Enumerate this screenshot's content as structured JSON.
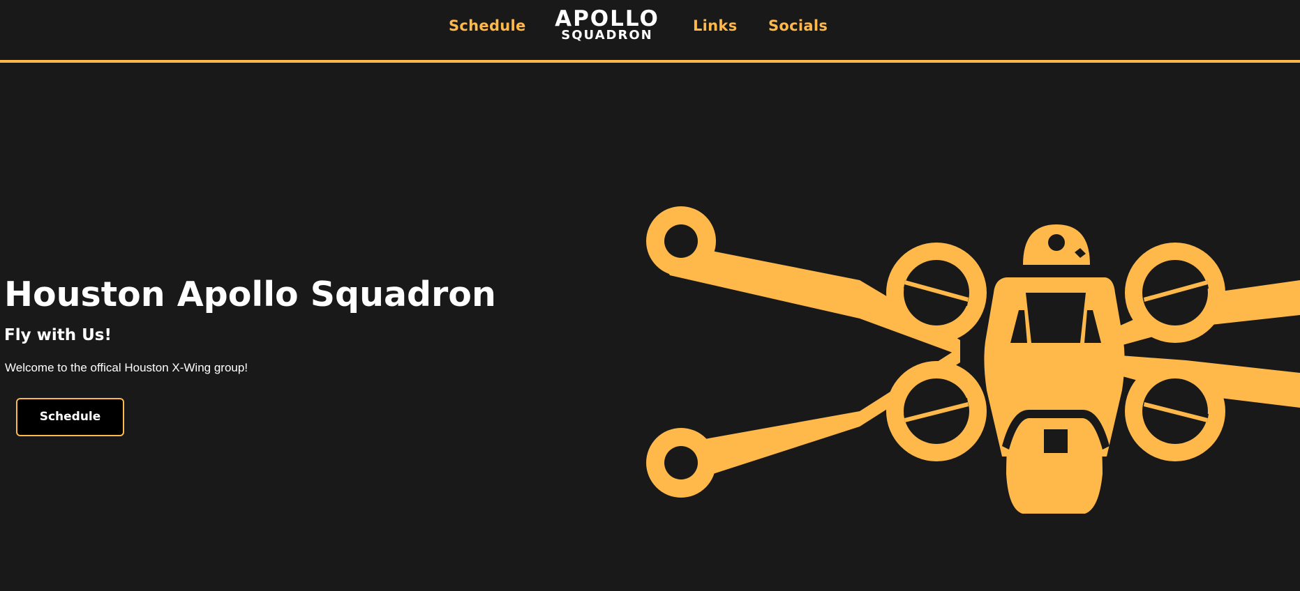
{
  "nav": {
    "links": [
      {
        "label": "Schedule"
      },
      {
        "label": "Links"
      },
      {
        "label": "Socials"
      }
    ],
    "logo": {
      "line1": "APOLLO",
      "line2": "SQUADRON"
    }
  },
  "hero": {
    "title": "Houston Apollo Squadron",
    "subtitle": "Fly with Us!",
    "text": "Welcome to the offical Houston X-Wing group!",
    "button_label": "Schedule",
    "graphic_icon": "x-wing-icon"
  },
  "colors": {
    "background": "#191919",
    "accent": "#ffb84a",
    "text": "#ffffff",
    "button_bg": "#000000"
  }
}
